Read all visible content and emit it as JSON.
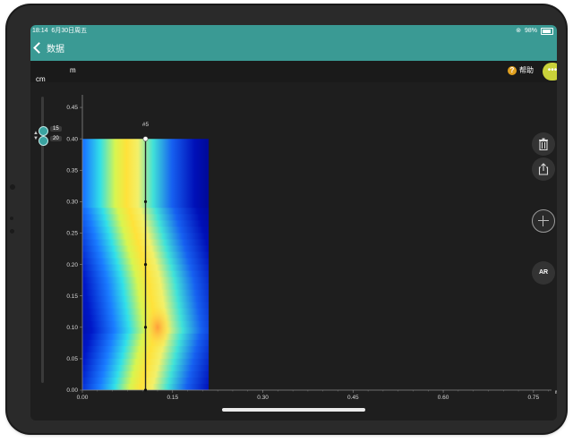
{
  "status_bar": {
    "time": "18:14",
    "date": "6月30日周五",
    "battery": "98%"
  },
  "nav": {
    "back_label": "数据"
  },
  "toolbar": {
    "x_unit": "m",
    "help_label": "帮助",
    "more_icon": "•••"
  },
  "left_panel": {
    "y_unit": "cm",
    "slider_top_value": "15",
    "slider_bottom_value": "20"
  },
  "chart_data": {
    "type": "heatmap",
    "x_ticks": [
      "0.00",
      "0.15",
      "0.30",
      "0.45",
      "0.60",
      "0.75"
    ],
    "y_ticks": [
      "0.00",
      "0.05",
      "0.10",
      "0.15",
      "0.20",
      "0.25",
      "0.30",
      "0.35",
      "0.40",
      "0.45"
    ],
    "xlabel": "m",
    "xlim": [
      0,
      0.78
    ],
    "ylim": [
      0,
      0.47
    ],
    "heatmap_extent": {
      "x": [
        0,
        0.21
      ],
      "y": [
        0,
        0.4
      ]
    },
    "marker": {
      "label": "#5",
      "x": 0.105
    },
    "line_points": [
      {
        "x": 0.105,
        "y": 0.4
      },
      {
        "x": 0.105,
        "y": 0.3
      },
      {
        "x": 0.105,
        "y": 0.2
      },
      {
        "x": 0.105,
        "y": 0.1
      },
      {
        "x": 0.105,
        "y": 0.0
      }
    ],
    "colormap": "jet",
    "colors": {
      "background": "#1e1e1e",
      "axis": "#8a8a8a",
      "line": "#222222"
    }
  }
}
